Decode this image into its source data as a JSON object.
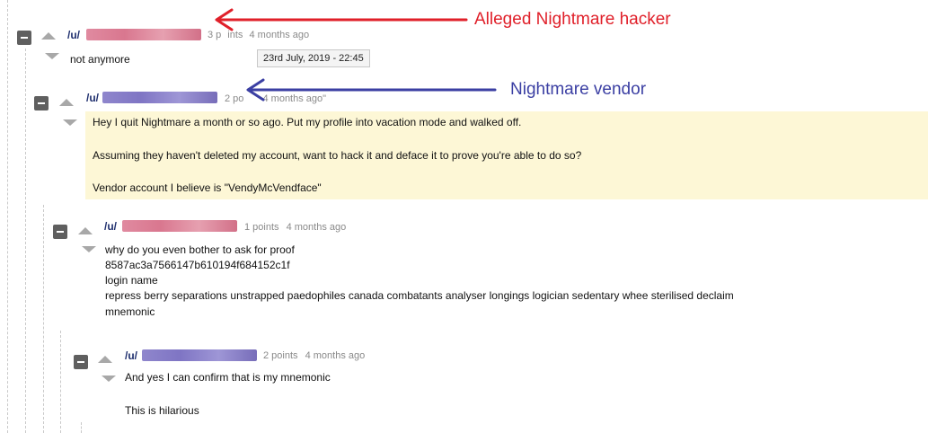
{
  "comments": [
    {
      "prefix": "/u/",
      "meta_a": "3 p",
      "meta_b": "ints",
      "time": "4 months ago",
      "lines": [
        "not anymore"
      ]
    },
    {
      "prefix": "/u/",
      "meta_a": "2 po",
      "time": "4 months ago\"",
      "lines": [
        "Hey I quit Nightmare a month or so ago. Put my profile into vacation mode and walked off.",
        "Assuming they haven't deleted my account, want to hack it and deface it to prove you're able to do so?",
        "Vendor account I believe is \"VendyMcVendface\""
      ]
    },
    {
      "prefix": "/u/",
      "meta": "1 points",
      "time": "4 months ago",
      "lines": [
        "why do you even bother to ask for proof",
        "8587ac3a7566147b610194f684152c1f",
        "login name",
        "repress berry separations unstrapped paedophiles canada combatants analyser longings logician sedentary whee sterilised declaim",
        "mnemonic"
      ]
    },
    {
      "prefix": "/u/",
      "meta": "2 points",
      "time": "4 months ago",
      "lines": [
        "And yes I can confirm that is my mnemonic",
        "This is hilarious"
      ]
    }
  ],
  "tooltip": "23rd July, 2019 - 22:45",
  "annotations": {
    "hacker": "Alleged Nightmare hacker",
    "vendor": "Nightmare vendor",
    "hacker_color": "#e0202a",
    "vendor_color": "#3b3fa3"
  }
}
